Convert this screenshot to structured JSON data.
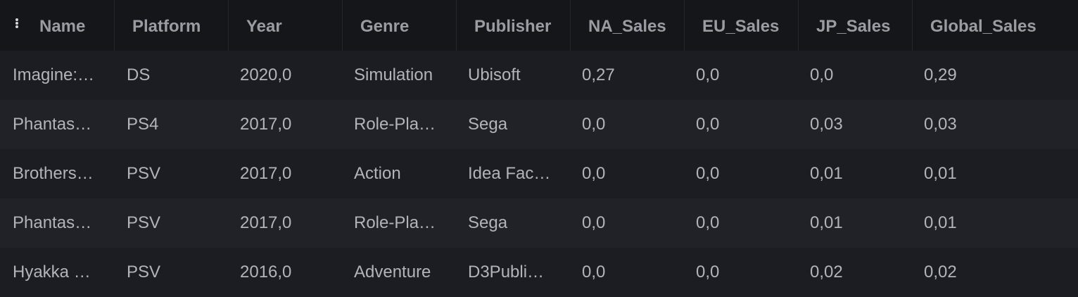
{
  "columns": [
    "Name",
    "Platform",
    "Year",
    "Genre",
    "Publisher",
    "NA_Sales",
    "EU_Sales",
    "JP_Sales",
    "Global_Sales"
  ],
  "rows": [
    [
      "Imagine:…",
      "DS",
      "2020,0",
      "Simulation",
      "Ubisoft",
      "0,27",
      "0,0",
      "0,0",
      "0,29"
    ],
    [
      "Phantas…",
      "PS4",
      "2017,0",
      "Role-Pla…",
      "Sega",
      "0,0",
      "0,0",
      "0,03",
      "0,03"
    ],
    [
      "Brothers…",
      "PSV",
      "2017,0",
      "Action",
      "Idea Fac…",
      "0,0",
      "0,0",
      "0,01",
      "0,01"
    ],
    [
      "Phantas…",
      "PSV",
      "2017,0",
      "Role-Pla…",
      "Sega",
      "0,0",
      "0,0",
      "0,01",
      "0,01"
    ],
    [
      "Hyakka …",
      "PSV",
      "2016,0",
      "Adventure",
      "D3Publi…",
      "0,0",
      "0,0",
      "0,02",
      "0,02"
    ]
  ],
  "icons": {
    "column_menu": "more-vertical-icon"
  },
  "colors": {
    "background": "#1c1d22",
    "header_background": "#15161a",
    "text": "#b2b4b9",
    "header_text": "#9a9ca3"
  }
}
